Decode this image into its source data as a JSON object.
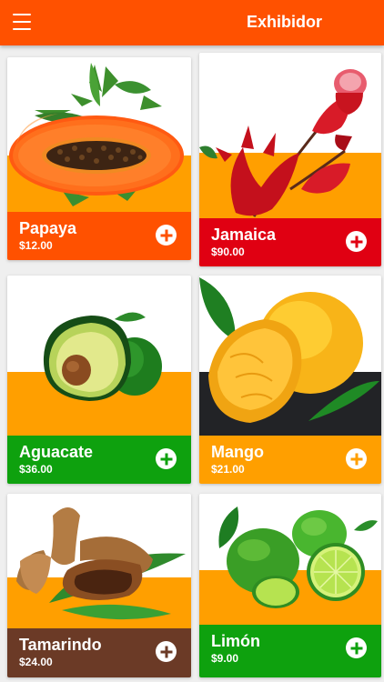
{
  "app": {
    "title": "Exhibidor",
    "menu_icon": "hamburger-menu-icon",
    "accent": "#ff5100"
  },
  "products": [
    {
      "name": "Papaya",
      "price": "$12.00",
      "band_color": "#ff9f00",
      "info_color": "#ff5100",
      "icon": "plus-icon"
    },
    {
      "name": "Jamaica",
      "price": "$90.00",
      "band_color": "#ff9f00",
      "info_color": "#e00012",
      "icon": "plus-icon"
    },
    {
      "name": "Aguacate",
      "price": "$36.00",
      "band_color": "#ff9f00",
      "info_color": "#0ea10e",
      "icon": "plus-icon"
    },
    {
      "name": "Mango",
      "price": "$21.00",
      "band_color": "#222326",
      "info_color": "#ff9f00",
      "icon": "plus-icon"
    },
    {
      "name": "Tamarindo",
      "price": "$24.00",
      "band_color": "#ff9f00",
      "info_color": "#6b3a26",
      "icon": "plus-icon"
    },
    {
      "name": "Limón",
      "price": "$9.00",
      "band_color": "#ff9f00",
      "info_color": "#0ea10e",
      "icon": "plus-icon"
    }
  ]
}
